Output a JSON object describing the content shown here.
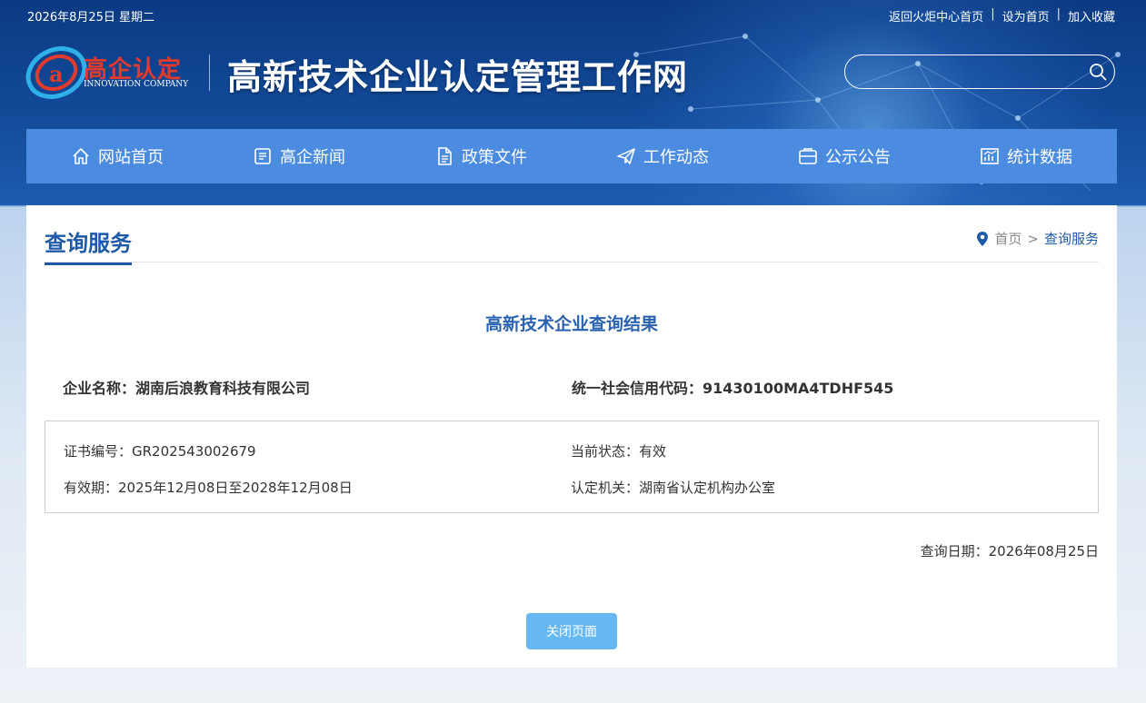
{
  "topbar": {
    "date": "2026年8月25日 星期二",
    "links": [
      "返回火炬中心首页",
      "设为首页",
      "加入收藏"
    ]
  },
  "logo": {
    "name": "高企认定",
    "subtitle": "INNOVATION COMPANY"
  },
  "site_title": "高新技术企业认定管理工作网",
  "search": {
    "value": "",
    "placeholder": ""
  },
  "nav": [
    {
      "label": "网站首页",
      "icon": "home-icon"
    },
    {
      "label": "高企新闻",
      "icon": "news-icon"
    },
    {
      "label": "政策文件",
      "icon": "document-icon"
    },
    {
      "label": "工作动态",
      "icon": "paper-plane-icon"
    },
    {
      "label": "公示公告",
      "icon": "announcement-icon"
    },
    {
      "label": "统计数据",
      "icon": "chart-icon"
    }
  ],
  "section": {
    "title": "查询服务",
    "breadcrumb": {
      "home": "首页",
      "separator": ">",
      "current": "查询服务"
    }
  },
  "result": {
    "title": "高新技术企业查询结果",
    "company_label": "企业名称：",
    "company_value": "湖南后浪教育科技有限公司",
    "credit_label": "统一社会信用代码：",
    "credit_value": "91430100MA4TDHF545",
    "cert_no_label": "证书编号：",
    "cert_no_value": "GR202543002679",
    "status_label": "当前状态：",
    "status_value": "有效",
    "validity_label": "有效期：",
    "validity_value": "2025年12月08日至2028年12月08日",
    "authority_label": "认定机关：",
    "authority_value": "湖南省认定机构办公室",
    "query_date_label": "查询日期：",
    "query_date_value": "2026年08月25日",
    "close_button": "关闭页面"
  },
  "colors": {
    "nav_bg": "#4b8ce0",
    "accent": "#1f5aa8",
    "button": "#65b8f2"
  }
}
